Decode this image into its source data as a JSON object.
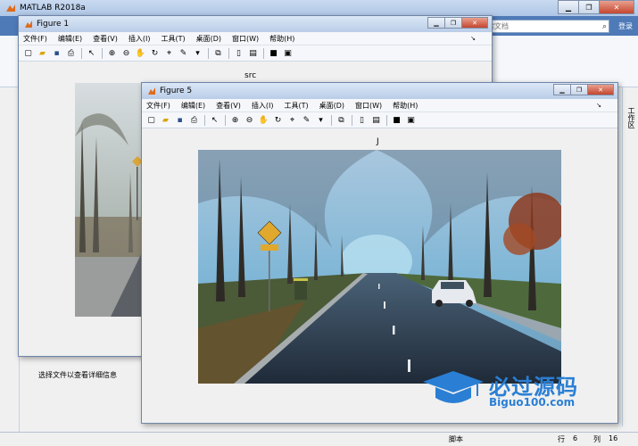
{
  "main": {
    "title": "MATLAB R2018a",
    "search_placeholder": "搜索文档",
    "login": "登录",
    "detail_hint": "选择文件以查看详细信息",
    "right_panel_label": "工作区",
    "status": {
      "script": "脚本",
      "row_label": "行",
      "row": "6",
      "col_label": "列",
      "col": "16"
    }
  },
  "figure1": {
    "title": "Figure 1",
    "menu": [
      "文件(F)",
      "编辑(E)",
      "查看(V)",
      "插入(I)",
      "工具(T)",
      "桌面(D)",
      "窗口(W)",
      "帮助(H)"
    ],
    "axes_title": "src"
  },
  "figure5": {
    "title": "Figure 5",
    "menu": [
      "文件(F)",
      "编辑(E)",
      "查看(V)",
      "插入(I)",
      "工具(T)",
      "桌面(D)",
      "窗口(W)",
      "帮助(H)"
    ],
    "axes_title": "J"
  },
  "watermark": {
    "cn": "必过源码",
    "en": "Biguo100.com"
  },
  "colors": {
    "ribbon": "#4f7ab8",
    "watermark": "#2a7fd4",
    "road": "#2c3a4d"
  }
}
